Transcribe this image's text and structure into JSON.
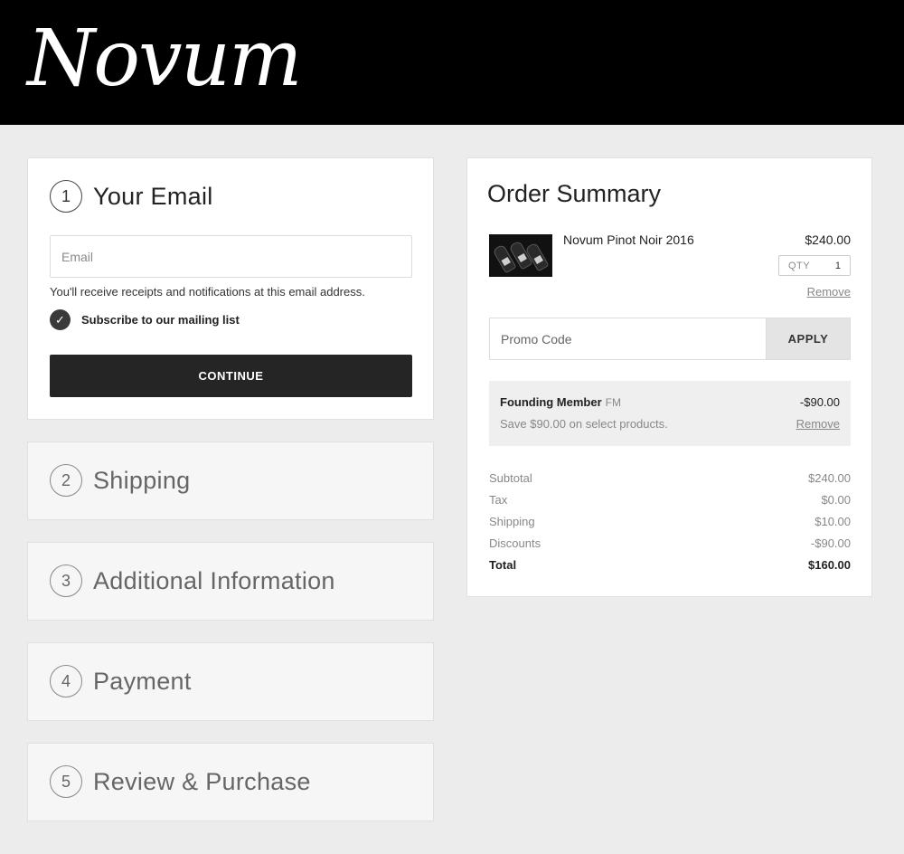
{
  "brand": {
    "name": "Novum"
  },
  "steps": [
    {
      "number": "1",
      "title": "Your Email"
    },
    {
      "number": "2",
      "title": "Shipping"
    },
    {
      "number": "3",
      "title": "Additional Information"
    },
    {
      "number": "4",
      "title": "Payment"
    },
    {
      "number": "5",
      "title": "Review & Purchase"
    }
  ],
  "email_step": {
    "placeholder": "Email",
    "value": "",
    "help_text": "You'll receive receipts and notifications at this email address.",
    "subscribe_label": "Subscribe to our mailing list",
    "subscribe_checked": true,
    "continue_label": "CONTINUE"
  },
  "order_summary": {
    "title": "Order Summary",
    "item": {
      "name": "Novum Pinot Noir 2016",
      "price": "$240.00",
      "qty_label": "QTY",
      "qty": "1",
      "remove_label": "Remove"
    },
    "promo": {
      "placeholder": "Promo Code",
      "apply_label": "APPLY"
    },
    "discount": {
      "name": "Founding Member",
      "code": "FM",
      "amount": "-$90.00",
      "description": "Save $90.00 on select products.",
      "remove_label": "Remove"
    },
    "totals": [
      {
        "label": "Subtotal",
        "value": "$240.00"
      },
      {
        "label": "Tax",
        "value": "$0.00"
      },
      {
        "label": "Shipping",
        "value": "$10.00"
      },
      {
        "label": "Discounts",
        "value": "-$90.00"
      },
      {
        "label": "Total",
        "value": "$160.00"
      }
    ]
  }
}
